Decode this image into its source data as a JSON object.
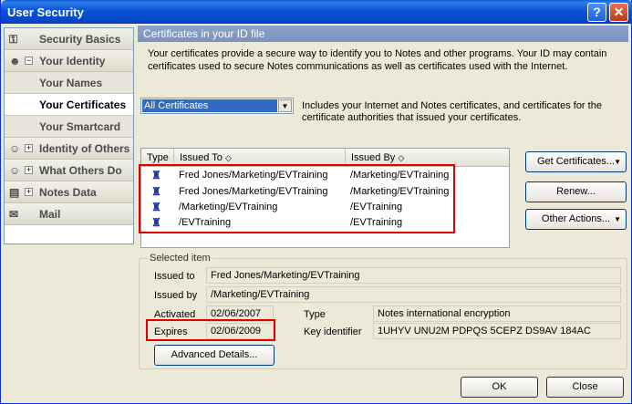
{
  "window": {
    "title": "User Security",
    "help_label": "?",
    "close_label": "✕"
  },
  "sidebar": {
    "items": [
      {
        "label": "Security Basics",
        "icon": "key-icon"
      },
      {
        "label": "Your Identity",
        "icon": "identity-icon",
        "expander": "−"
      },
      {
        "label": "Your Names"
      },
      {
        "label": "Your Certificates"
      },
      {
        "label": "Your Smartcard"
      },
      {
        "label": "Identity of Others",
        "icon": "people-icon",
        "expander": "+"
      },
      {
        "label": "What Others Do",
        "icon": "people-icon",
        "expander": "+"
      },
      {
        "label": "Notes Data",
        "icon": "database-icon",
        "expander": "+"
      },
      {
        "label": "Mail",
        "icon": "envelope-icon"
      }
    ]
  },
  "panel": {
    "header": "Certificates in your ID file",
    "intro": "Your certificates provide a secure way to identify you to Notes and other programs. Your ID may contain certificates used to secure Notes communications as well as certificates used with the Internet.",
    "filter": {
      "value": "All Certificates",
      "description": "Includes your Internet and Notes certificates, and certificates for the certificate authorities that issued your certificates."
    }
  },
  "list": {
    "columns": {
      "type": "Type",
      "issued_to": "Issued To",
      "issued_by": "Issued By"
    },
    "rows": [
      {
        "issued_to": "Fred Jones/Marketing/EVTraining",
        "issued_by": "/Marketing/EVTraining"
      },
      {
        "issued_to": "Fred Jones/Marketing/EVTraining",
        "issued_by": "/Marketing/EVTraining"
      },
      {
        "issued_to": "/Marketing/EVTraining",
        "issued_by": "/EVTraining"
      },
      {
        "issued_to": "/EVTraining",
        "issued_by": "/EVTraining"
      }
    ]
  },
  "actions": {
    "get_certificates": "Get Certificates...",
    "renew": "Renew...",
    "other_actions": "Other Actions..."
  },
  "selected": {
    "title": "Selected item",
    "issued_to_label": "Issued to",
    "issued_to": "Fred Jones/Marketing/EVTraining",
    "issued_by_label": "Issued by",
    "issued_by": "/Marketing/EVTraining",
    "activated_label": "Activated",
    "activated": "02/06/2007",
    "expires_label": "Expires",
    "expires": "02/06/2009",
    "type_label": "Type",
    "type": "Notes international encryption",
    "key_label": "Key identifier",
    "key": "1UHYV UNU2M PDPQS 5CEPZ DS9AV 184AC",
    "advanced_label": "Advanced Details..."
  },
  "footer": {
    "ok": "OK",
    "close": "Close"
  },
  "colors": {
    "highlight": "#e00000",
    "title_bar": "#0a55d6",
    "selection": "#316ac5"
  }
}
